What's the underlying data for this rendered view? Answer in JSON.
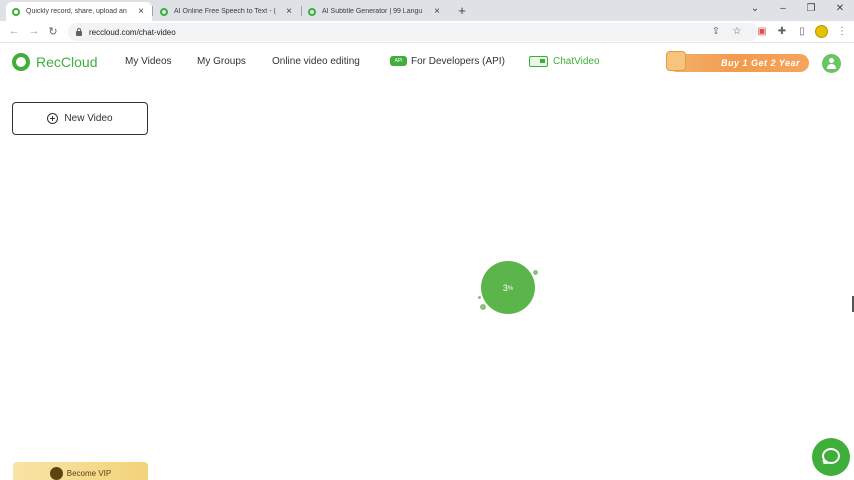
{
  "browser": {
    "tabs": [
      {
        "title": "Quickly record, share, upload an",
        "active": true
      },
      {
        "title": "AI Online Free Speech to Text - (",
        "active": false
      },
      {
        "title": "AI Subtitle Generator | 99 Langu",
        "active": false
      }
    ],
    "new_tab_label": "+",
    "url": "reccloud.com/chat-video"
  },
  "site": {
    "brand": "RecCloud",
    "nav": {
      "my_videos": "My Videos",
      "my_groups": "My Groups",
      "online_editing": "Online video editing",
      "api_badge": "API",
      "developers": "For Developers (API)",
      "chatvideo": "ChatVideo"
    },
    "promo": "Buy 1 Get 2 Year",
    "accent": "#3fae3a",
    "promo_color": "#f29a4d"
  },
  "sidebar": {
    "new_video": "New Video",
    "become_vip": "Become VIP"
  },
  "loader": {
    "value": "3",
    "unit": "%"
  }
}
